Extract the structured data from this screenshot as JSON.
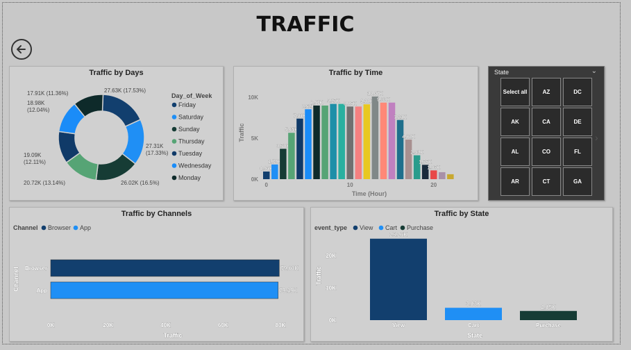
{
  "page": {
    "title": "TRAFFIC"
  },
  "icons": {
    "back": "back-arrow-icon",
    "next": "chevron-right-icon",
    "dropdown": "chevron-down-icon"
  },
  "slicer": {
    "title": "State",
    "tiles": [
      "Select all",
      "AZ",
      "DC",
      "AK",
      "CA",
      "DE",
      "AL",
      "CO",
      "FL",
      "AR",
      "CT",
      "GA"
    ]
  },
  "chart_data": [
    {
      "id": "days",
      "type": "pie",
      "donut": true,
      "title": "Traffic by Days",
      "legend_title": "Day_of_Week",
      "legend_placement": "right",
      "labels": [
        "Friday",
        "Saturday",
        "Sunday",
        "Thursday",
        "Tuesday",
        "Wednesday",
        "Monday"
      ],
      "values": [
        27.63,
        27.31,
        26.02,
        20.72,
        19.09,
        18.98,
        17.91
      ],
      "data_labels": [
        "27.63K (17.53%)",
        "27.31K\n(17.33%)",
        "26.02K (16.5%)",
        "20.72K (13.14%)",
        "19.09K\n(12.11%)",
        "18.98K\n(12.04%)",
        "17.91K (11.36%)"
      ],
      "colors": [
        "#123f6e",
        "#1f8ff5",
        "#163c35",
        "#56a475",
        "#103a68",
        "#1a8cf8",
        "#0e2a2a"
      ]
    },
    {
      "id": "time",
      "type": "bar",
      "title": "Traffic by Time",
      "xlabel": "Time (Hour)",
      "ylabel": "Traffic",
      "y_ticks": [
        "0K",
        "5K",
        "10K"
      ],
      "x_ticks": [
        "0",
        "10",
        "20"
      ],
      "ylim": [
        0,
        11000
      ],
      "values": [
        0.93,
        1.79,
        3.7,
        5.65,
        7.38,
        8.52,
        8.97,
        8.97,
        9.17,
        9.17,
        8.85,
        8.85,
        9.12,
        10.07,
        9.33,
        9.33,
        7.21,
        4.82,
        2.91,
        1.75,
        1.07,
        0.85,
        0.6
      ],
      "data_labels": [
        "0.93K",
        "1.79K",
        "3.70K",
        "5.65K",
        "7.38K",
        "8.52K",
        "8.97K",
        "",
        "9.17K",
        "",
        "8.85K",
        "",
        "9.12K",
        "10.07K",
        "9.33K",
        "",
        "7.21K",
        "4.82K",
        "2.91K",
        "1.75K",
        "1.07K",
        "",
        ""
      ],
      "colors": [
        "#123f6e",
        "#1f8ff5",
        "#163c35",
        "#56a475",
        "#103a68",
        "#1a8cf8",
        "#0e2a2a",
        "#56a475",
        "#1e8fa8",
        "#2ab0a0",
        "#707070",
        "#f58080",
        "#e8c820",
        "#808888",
        "#ff8877",
        "#c080c0",
        "#1f6f8c",
        "#a89090",
        "#2a9c8c",
        "#1a2b3c",
        "#e84848",
        "#a890a8",
        "#c8a830"
      ]
    },
    {
      "id": "channels",
      "type": "bar",
      "orientation": "horizontal",
      "title": "Traffic by Channels",
      "legend_title": "Channel",
      "legend": [
        "Browser",
        "App"
      ],
      "legend_placement": "top-left",
      "categories": [
        "Browser",
        "App"
      ],
      "values": [
        79.6,
        79.19
      ],
      "data_labels": [
        "79.60K",
        "79.19K"
      ],
      "x_ticks": [
        "0K",
        "20K",
        "40K",
        "60K",
        "80K"
      ],
      "xlim": [
        0,
        80
      ],
      "xlabel": "Traffic",
      "ylabel": "Channel",
      "colors": [
        "#123f6e",
        "#1f8ff5"
      ]
    },
    {
      "id": "state",
      "type": "bar",
      "title": "Traffic by State",
      "legend_title": "event_type",
      "legend": [
        "View",
        "Cart",
        "Purchase"
      ],
      "legend_placement": "top-left",
      "categories": [
        "View",
        "Cart",
        "Purchase"
      ],
      "values": [
        25.26,
        3.83,
        2.85
      ],
      "data_labels": [
        "25.26K",
        "3.83K",
        "2.85K"
      ],
      "y_ticks": [
        "0K",
        "10K",
        "20K"
      ],
      "ylim": [
        0,
        28
      ],
      "xlabel": "State",
      "ylabel": "Traffic",
      "colors": [
        "#123f6e",
        "#1f8ff5",
        "#163c35"
      ]
    }
  ]
}
